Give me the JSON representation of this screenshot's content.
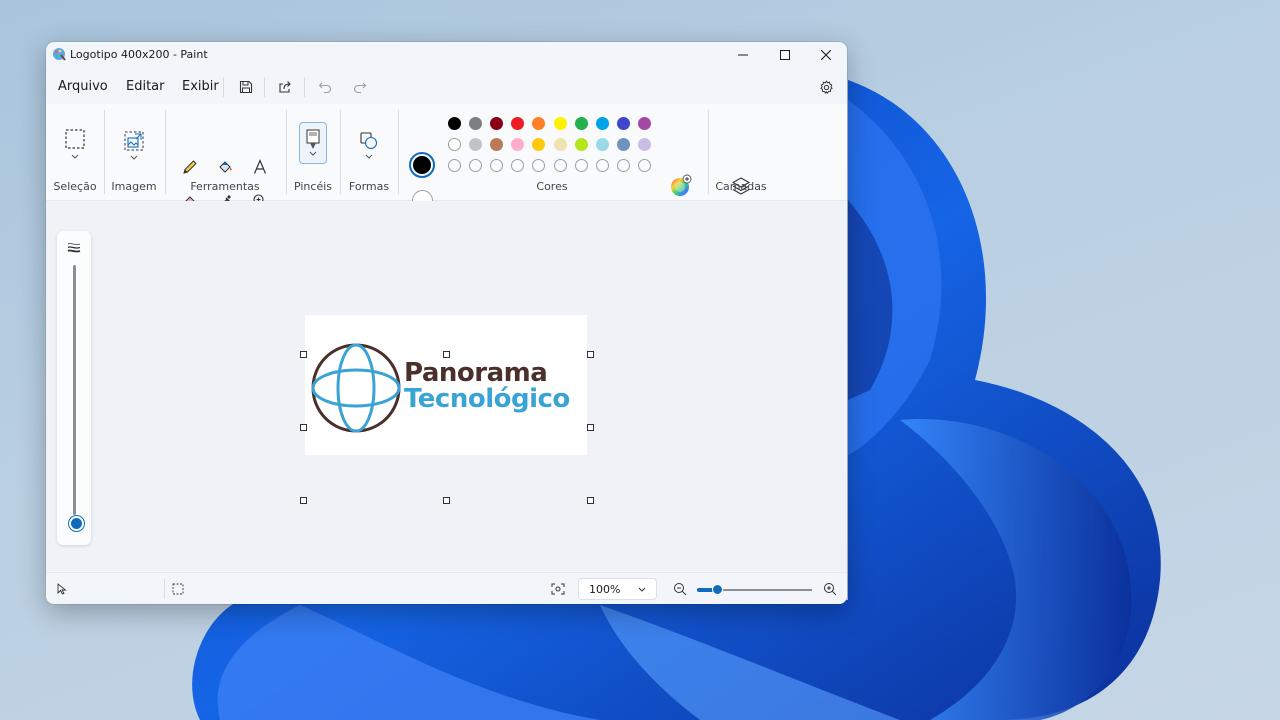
{
  "window": {
    "title": "Logotipo 400x200 - Paint"
  },
  "menu": {
    "items": [
      "Arquivo",
      "Editar",
      "Exibir"
    ]
  },
  "ribbon": {
    "groups": {
      "selection": "Seleção",
      "image": "Imagem",
      "tools": "Ferramentas",
      "brushes": "Pincéis",
      "shapes": "Formas",
      "colors": "Cores",
      "layers": "Camadas"
    },
    "primary_color": "#000000",
    "secondary_color": "#ffffff",
    "palette_row1": [
      "#000000",
      "#7f7f7f",
      "#880015",
      "#ed1c24",
      "#ff7f27",
      "#fff200",
      "#22b14c",
      "#00a2e8",
      "#3f48cc",
      "#a349a4"
    ],
    "palette_row2": [
      "#ffffff",
      "#c3c3c3",
      "#b97a57",
      "#ffaec9",
      "#ffc90e",
      "#efe4b0",
      "#b5e61d",
      "#99d9ea",
      "#7092be",
      "#c8bfe7"
    ],
    "custom_slots": 10
  },
  "document": {
    "logo_line1": "Panorama",
    "logo_line2": "Tecnológico"
  },
  "brush_size_level": 0.0,
  "status": {
    "zoom": "100%"
  }
}
